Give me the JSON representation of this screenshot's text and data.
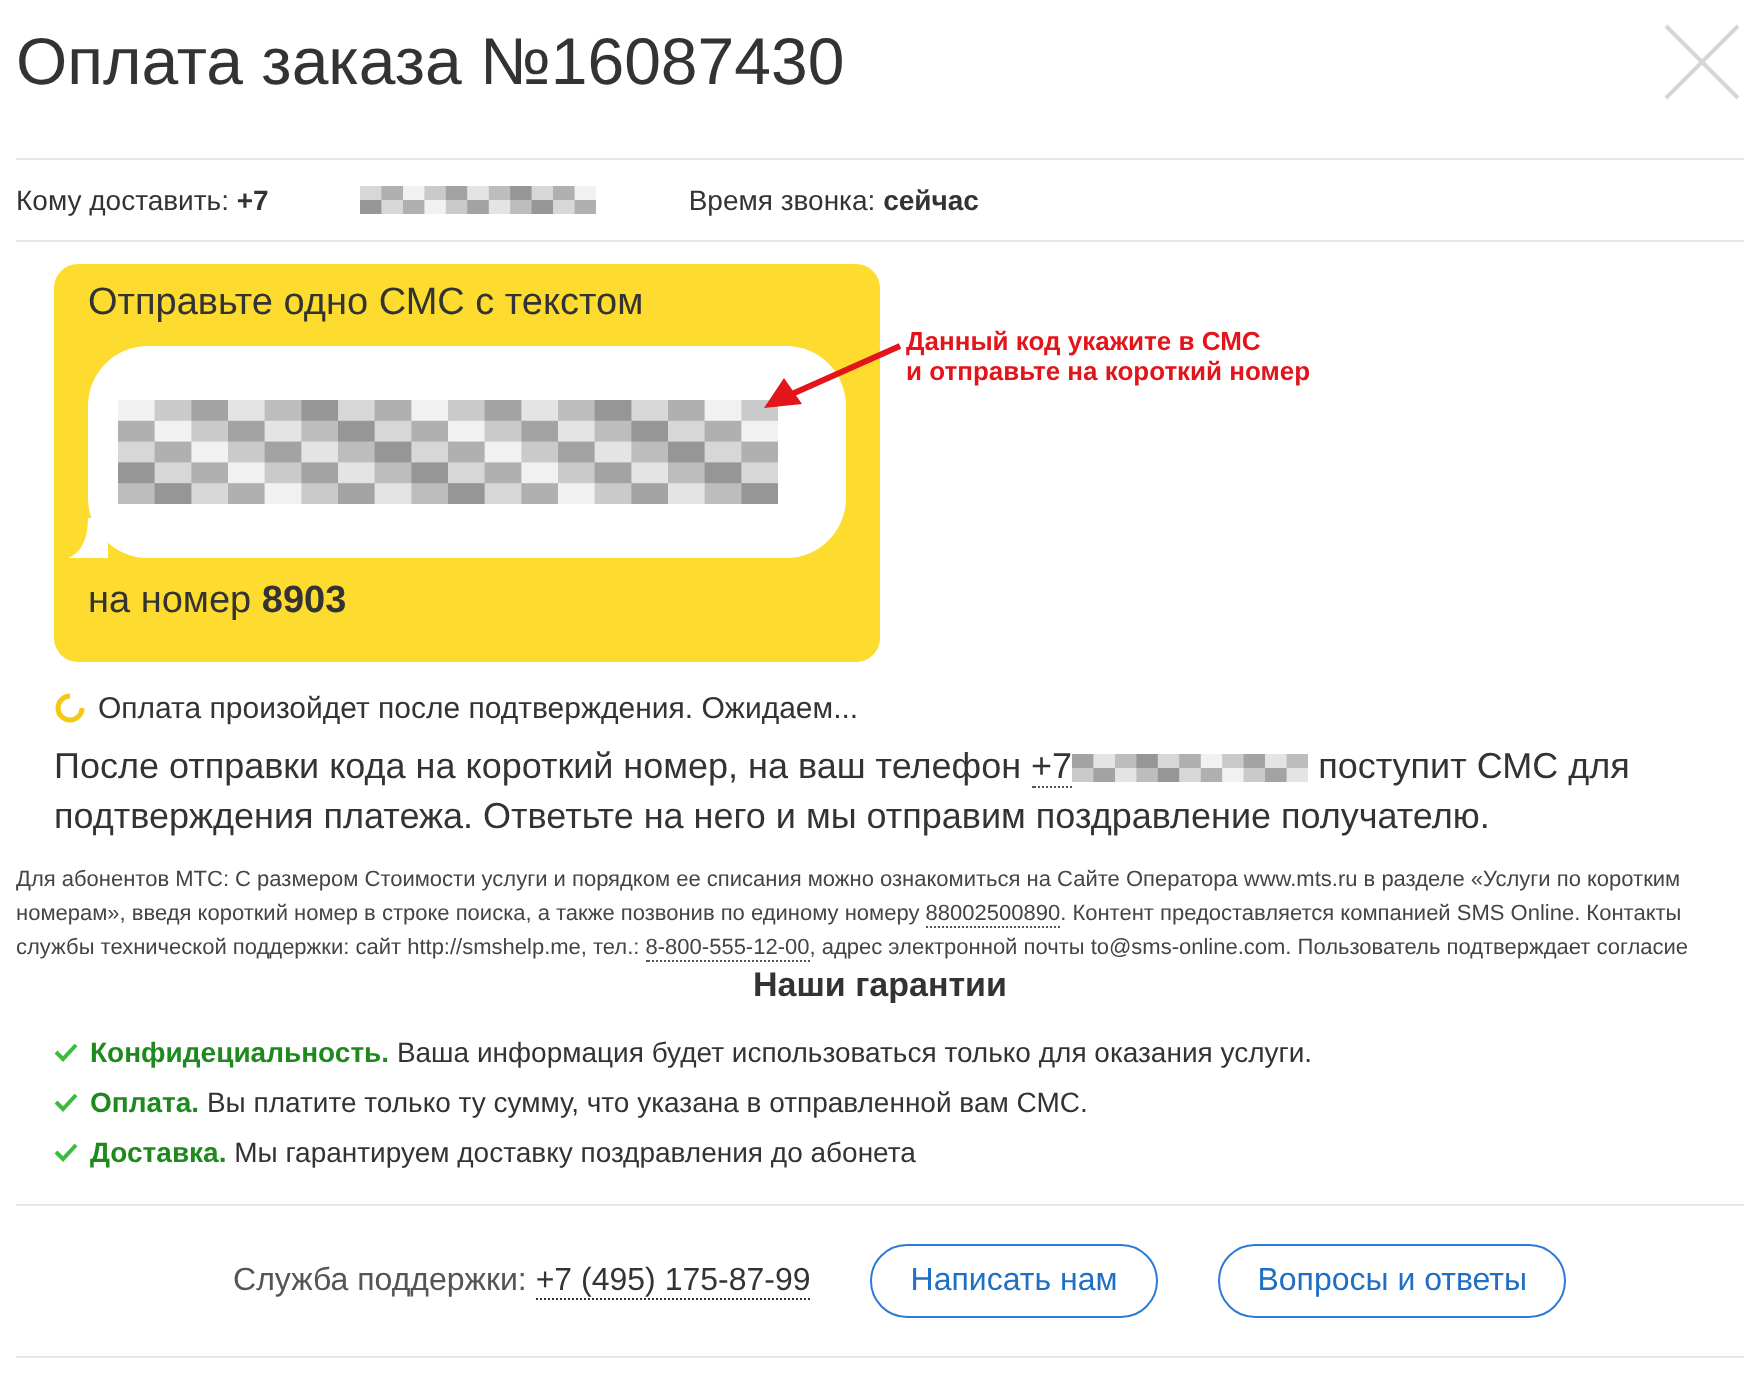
{
  "title": "Оплата заказа №16087430",
  "recipient": {
    "label": "Кому доставить:",
    "value": "+7"
  },
  "call_time": {
    "label": "Время звонка:",
    "value": "сейчас"
  },
  "sms_card": {
    "heading": "Отправьте одно СМС с текстом",
    "number_label": "на номер",
    "number": "8903"
  },
  "callout": [
    "Данный код укажите в СМС",
    "и отправьте на короткий номер"
  ],
  "status": "Оплата произойдет после подтверждения. Ожидаем...",
  "instructions": {
    "before": "После отправки кода на короткий номер, на ваш телефон",
    "phone": "+7",
    "after": "поступит СМС для подтверждения платежа. Ответьте на него и мы отправим поздравление получателю."
  },
  "legal": [
    {
      "kind": "text",
      "text": "Для абонентов МТС: С размером Стоимости услуги и порядком ее списания можно ознакомиться на Сайте Оператора www.mts.ru в разделе «Услуги по коротким номерам», введя короткий номер в строке поиска, а также позвонив по единому номеру "
    },
    {
      "kind": "link",
      "text": "88002500890"
    },
    {
      "kind": "text",
      "text": ". Контент предоставляется компанией SMS Online. Контакты службы технической поддержки: сайт http://smshelp.me, тел.: "
    },
    {
      "kind": "link",
      "text": "8-800-555-12-00"
    },
    {
      "kind": "text",
      "text": ", адрес электронной почты to@sms-online.com. Пользователь подтверждает согласие"
    }
  ],
  "guarantees": {
    "title": "Наши гарантии",
    "items": [
      {
        "title": "Конфидециальность.",
        "text": "Ваша информация будет использоваться только для оказания услуги."
      },
      {
        "title": "Оплата.",
        "text": "Вы платите только ту сумму, что указана в отправленной вам СМС."
      },
      {
        "title": "Доставка.",
        "text": "Мы гарантируем доставку поздравления до абонета"
      }
    ]
  },
  "footer": {
    "support_label": "Служба поддержки:",
    "support_phone": "+7 (495) 175-87-99",
    "buttons": [
      "Написать нам",
      "Вопросы и ответы"
    ]
  }
}
